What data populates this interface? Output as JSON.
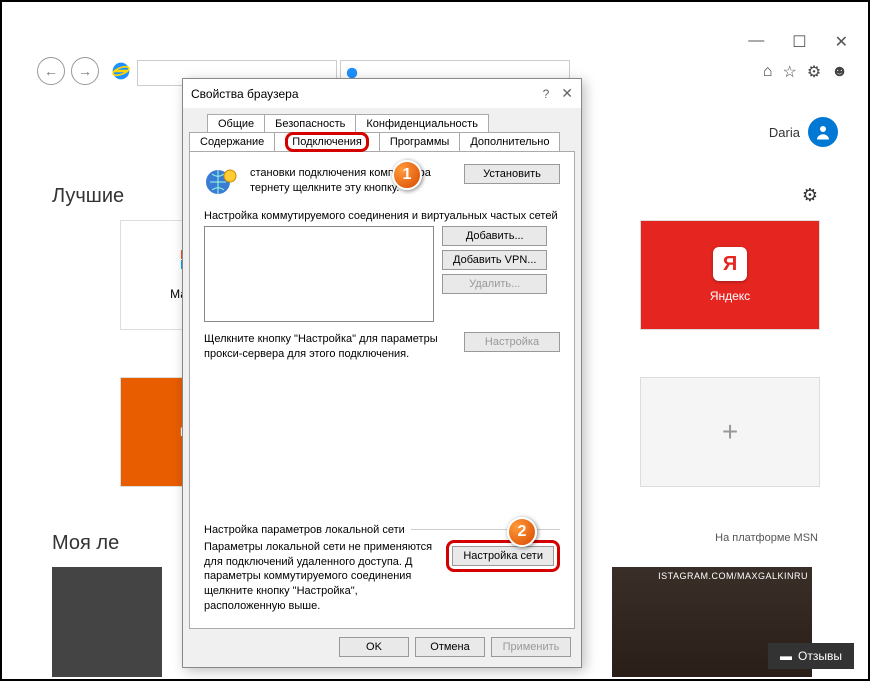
{
  "window": {
    "min": "—",
    "max": "☐",
    "close": "✕"
  },
  "toolbar": {
    "home": "⌂",
    "star": "☆",
    "gear": "⚙",
    "smile": "☻"
  },
  "user": {
    "name": "Daria"
  },
  "labels": {
    "best": "Лучшие",
    "feed": "Моя ле",
    "platform": "На платформе MSN"
  },
  "tiles": {
    "shop": "Магази",
    "kino": "Кин",
    "yandex": "Яндекс",
    "y_letter": "Я",
    "plus": "+"
  },
  "feed": {
    "instagram": "ISTAGRAM.COM/MAXGALKINRU"
  },
  "feedback": "Отзывы",
  "dialog": {
    "title": "Свойства браузера",
    "tabs": {
      "general": "Общие",
      "security": "Безопасность",
      "privacy": "Конфиденциальность",
      "content": "Содержание",
      "connections": "Подключения",
      "programs": "Программы",
      "advanced": "Дополнительно"
    },
    "setup_text": "становки подключения компьютера тернету щелкните эту кнопку.",
    "setup_btn": "Установить",
    "dialup_label": "Настройка коммутируемого соединения и виртуальных частых сетей",
    "add": "Добавить...",
    "add_vpn": "Добавить VPN...",
    "remove": "Удалить...",
    "settings": "Настройка",
    "proxy_hint": "Щелкните кнопку \"Настройка\" для параметры прокси-сервера для этого подключения.",
    "lan_label": "Настройка параметров локальной сети",
    "lan_text": "Параметры локальной сети не применяются для подключений удаленного доступа. Д параметры коммутируемого соединения щелкните кнопку \"Настройка\", расположенную выше.",
    "lan_btn": "Настройка сети",
    "ok": "OK",
    "cancel": "Отмена",
    "apply": "Применить"
  },
  "callouts": {
    "one": "1",
    "two": "2"
  }
}
